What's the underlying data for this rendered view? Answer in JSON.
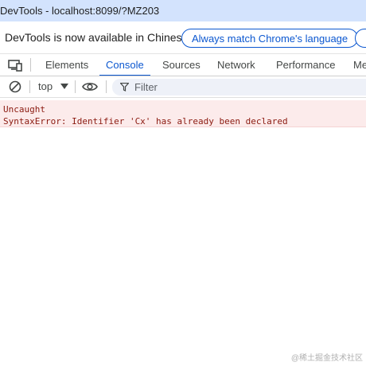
{
  "window": {
    "title": "DevTools - localhost:8099/?MZ203"
  },
  "infobar": {
    "message": "DevTools is now available in Chinese!",
    "button_label": "Always match Chrome's language"
  },
  "tabs": [
    {
      "label": "Elements",
      "active": false
    },
    {
      "label": "Console",
      "active": true
    },
    {
      "label": "Sources",
      "active": false
    },
    {
      "label": "Network",
      "active": false
    },
    {
      "label": "Performance",
      "active": false
    },
    {
      "label": "Me",
      "active": false
    }
  ],
  "toolbar": {
    "context_value": "top",
    "filter_placeholder": "Filter"
  },
  "console": {
    "error": {
      "line1": "Uncaught",
      "line2": "SyntaxError: Identifier 'Cx' has already been declared"
    }
  },
  "watermark": "@稀土掘金技术社区",
  "colors": {
    "titlebar_bg": "#d3e3fd",
    "accent": "#0b57d0",
    "error_bg": "#fcebeb",
    "error_text": "#8b1a10"
  },
  "icons": [
    "device-toggle-icon",
    "clear-console-icon",
    "eye-icon",
    "filter-icon",
    "dropdown-arrow-icon"
  ]
}
